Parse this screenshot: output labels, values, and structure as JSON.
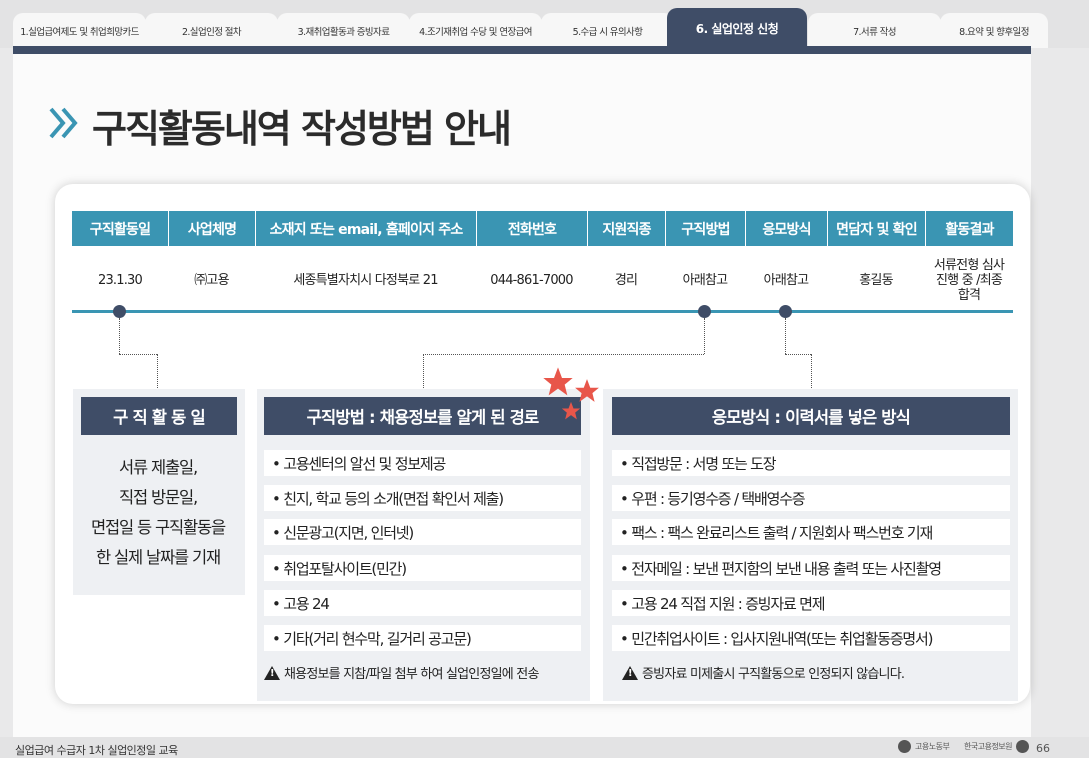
{
  "tabs": [
    {
      "label": "1.실업급여제도 및 취업희망카드",
      "active": false
    },
    {
      "label": "2.실업인정 절차",
      "active": false
    },
    {
      "label": "3.재취업활동과 증빙자료",
      "active": false
    },
    {
      "label": "4.조기재취업 수당 및 연장급여",
      "active": false
    },
    {
      "label": "5.수급 시 유의사항",
      "active": false
    },
    {
      "label": "6. 실업인정 신청",
      "active": true
    },
    {
      "label": "7.서류 작성",
      "active": false
    },
    {
      "label": "8.요약 및 향후일정",
      "active": false
    }
  ],
  "page_title": "구직활동내역 작성방법 안내",
  "table": {
    "headers": [
      "구직활동일",
      "사업체명",
      "소재지 또는 email, 홈페이지 주소",
      "전화번호",
      "지원직종",
      "구직방법",
      "응모방식",
      "면담자 및 확인",
      "활동결과"
    ],
    "row": [
      "23.1.30",
      "㈜고용",
      "세종특별자치시 다정북로 21",
      "044-861-7000",
      "경리",
      "아래참고",
      "아래참고",
      "홍길동",
      "서류전형 심사 진행 중 /최종 합격"
    ]
  },
  "panel_date": {
    "heading": "구 직 활 동 일",
    "lines": [
      "서류 제출일,",
      "직접 방문일,",
      "면접일 등 구직활동을",
      "한 실제 날짜를 기재"
    ]
  },
  "panel_method": {
    "heading": "구직방법 : 채용정보를 알게 된 경로",
    "items": [
      "• 고용센터의 알선 및 정보제공",
      "• 친지, 학교 등의 소개(면접 확인서 제출)",
      "• 신문광고(지면, 인터넷)",
      "• 취업포탈사이트(민간)",
      "• 고용 24",
      "• 기타(거리 현수막, 길거리 공고문)"
    ],
    "note": "채용정보를 지참/파일 첨부 하여 실업인정일에 전송"
  },
  "panel_apply": {
    "heading": "응모방식 : 이력서를 넣은 방식",
    "items": [
      "• 직접방문 : 서명 또는 도장",
      "• 우편 : 등기영수증 / 택배영수증",
      "• 팩스 : 팩스 완료리스트 출력 / 지원회사 팩스번호 기재",
      "• 전자메일 : 보낸 편지함의 보낸 내용 출력 또는 사진촬영",
      "• 고용 24 직접 지원 : 증빙자료 면제",
      "• 민간취업사이트 : 입사지원내역(또는 취업활동증명서)"
    ],
    "note": "증빙자료 미제출시 구직활동으로 인정되지 않습니다."
  },
  "footer": {
    "text": "실업급여 수급자 1차 실업인정일 교육",
    "logo1": "고용노동부",
    "logo2": "한국고용정보원",
    "page_number": "66"
  },
  "colors": {
    "navy": "#3f4d67",
    "teal": "#3a95b3",
    "star": "#e8564a"
  }
}
